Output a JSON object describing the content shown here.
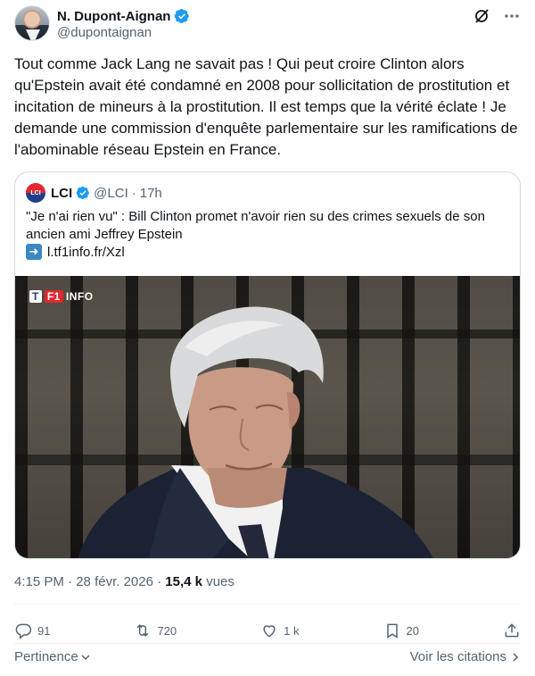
{
  "author": {
    "name": "N. Dupont-Aignan",
    "handle": "@dupontaignan"
  },
  "tweet": {
    "text": "Tout comme Jack Lang ne savait pas ! Qui peut croire Clinton alors qu'Epstein avait été condamné en 2008 pour sollicitation de prostitution et incitation de mineurs à la prostitution. Il est temps que la vérité éclate ! Je demande une commission d'enquête parlementaire sur les ramifications de l'abominable réseau Epstein en France."
  },
  "quote": {
    "name": "LCI",
    "logo_text": "LCI",
    "handle": "@LCI",
    "separator": "·",
    "time": "17h",
    "text": "\"Je n'ai rien vu\" : Bill Clinton promet n'avoir rien su des crimes sexuels de son ancien ami Jeffrey Epstein",
    "link": "l.tf1info.fr/Xzl",
    "image_badge": {
      "t": "T",
      "one": "F1",
      "info": "INFO"
    }
  },
  "meta": {
    "time": "4:15 PM",
    "separator": "·",
    "date": "28 févr. 2026",
    "views_count": "15,4 k",
    "views_label": "vues"
  },
  "actions": {
    "replies": "91",
    "reposts": "720",
    "likes": "1 k",
    "bookmarks": "20"
  },
  "footer": {
    "sort_label": "Pertinence",
    "citations_label": "Voir les citations"
  },
  "colors": {
    "verified": "#1d9bf0",
    "muted": "#536471",
    "text": "#0f1419"
  }
}
